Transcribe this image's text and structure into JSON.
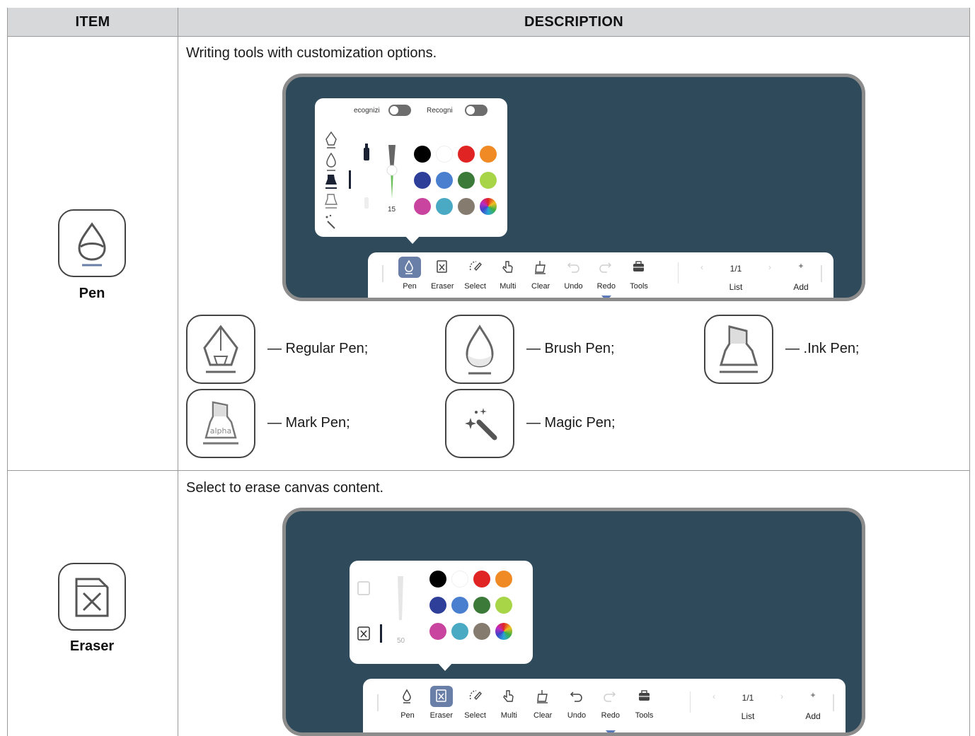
{
  "table": {
    "headers": [
      "ITEM",
      "DESCRIPTION"
    ]
  },
  "rows": [
    {
      "item": "Pen",
      "description": "Writing tools with customization options.",
      "popup": {
        "toggle1_label": "ecognizi",
        "toggle2_label": "Recogni",
        "size_value": "15",
        "colors": [
          "#000000",
          "#ffffff",
          "#e02424",
          "#f08a24",
          "#2e3f9a",
          "#4a7fd0",
          "#3c7a3a",
          "#a8d448",
          "#c8449e",
          "#4aaac4",
          "#857b6e",
          "rainbow"
        ]
      },
      "toolbar": {
        "buttons": [
          "Pen",
          "Eraser",
          "Select",
          "Multi",
          "Clear",
          "Undo",
          "Redo",
          "Tools"
        ],
        "page": "1/1",
        "list": "List",
        "add": "Add"
      },
      "pen_types": [
        "— Regular Pen;",
        "— Brush Pen;",
        "— .Ink Pen;",
        "— Mark Pen;",
        "— Magic Pen;"
      ],
      "mark_pen_icon_text": "alpha"
    },
    {
      "item": "Eraser",
      "description": "Select to erase canvas content.",
      "popup": {
        "size_value": "50",
        "colors": [
          "#000000",
          "#ffffff",
          "#e02424",
          "#f08a24",
          "#2e3f9a",
          "#4a7fd0",
          "#3c7a3a",
          "#a8d448",
          "#c8449e",
          "#4aaac4",
          "#857b6e",
          "rainbow"
        ]
      },
      "toolbar": {
        "buttons": [
          "Pen",
          "Eraser",
          "Select",
          "Multi",
          "Clear",
          "Undo",
          "Redo",
          "Tools"
        ],
        "page": "1/1",
        "list": "List",
        "add": "Add"
      }
    }
  ]
}
